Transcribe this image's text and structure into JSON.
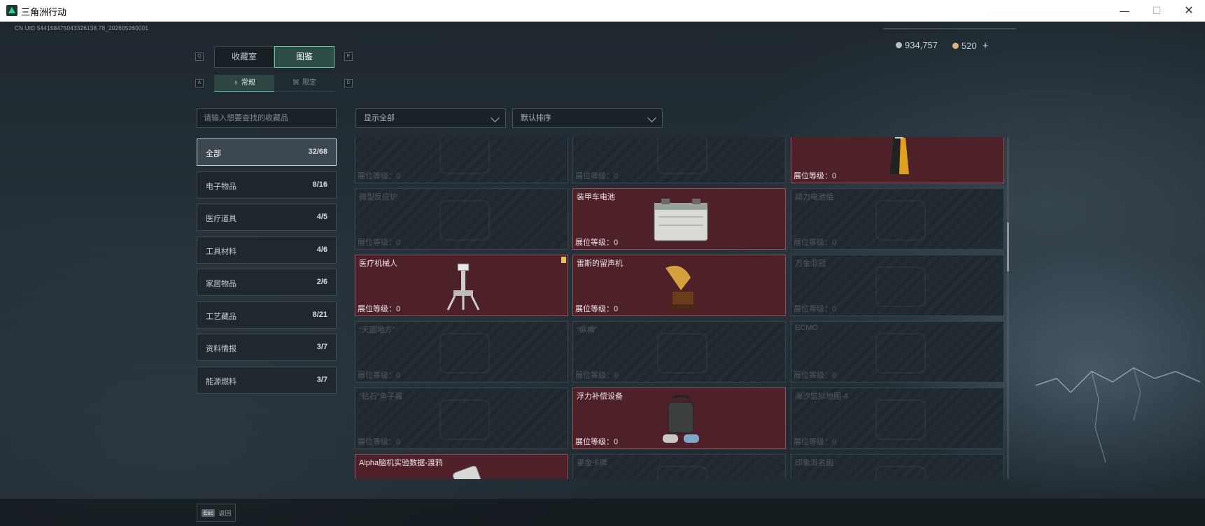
{
  "window": {
    "title": "三角洲行动"
  },
  "uid": "CN UID 544158475043326138 78_202605260001",
  "currency": {
    "silver": "934,757",
    "gold": "520",
    "plus": "+"
  },
  "tabs": [
    {
      "label": "收藏室",
      "key": "Q"
    },
    {
      "label": "图鉴",
      "key": "E"
    }
  ],
  "subtabs": [
    {
      "label": "常规",
      "key": "A"
    },
    {
      "label": "限定",
      "key": "D"
    }
  ],
  "search": {
    "placeholder": "请输入想要查找的收藏品"
  },
  "filters": {
    "show": "显示全部",
    "sort": "默认排序"
  },
  "categories": [
    {
      "name": "全部",
      "count": "32/68"
    },
    {
      "name": "电子物品",
      "count": "8/16"
    },
    {
      "name": "医疗道具",
      "count": "4/5"
    },
    {
      "name": "工具材料",
      "count": "4/6"
    },
    {
      "name": "家居物品",
      "count": "2/6"
    },
    {
      "name": "工艺藏品",
      "count": "8/21"
    },
    {
      "name": "资料情报",
      "count": "3/7"
    },
    {
      "name": "能源燃料",
      "count": "3/7"
    }
  ],
  "level_label": "展位等级：",
  "items": [
    {
      "name": "",
      "level": "0",
      "owned": false
    },
    {
      "name": "",
      "level": "0",
      "owned": false
    },
    {
      "name": "",
      "level": "0",
      "owned": true,
      "art": "bag-icon"
    },
    {
      "name": "微型反应炉",
      "level": "0",
      "owned": false
    },
    {
      "name": "装甲车电池",
      "level": "0",
      "owned": true,
      "art": "battery-icon"
    },
    {
      "name": "动力电池组",
      "level": "0",
      "owned": false
    },
    {
      "name": "医疗机械人",
      "level": "0",
      "owned": true,
      "art": "robot-icon",
      "flag": true
    },
    {
      "name": "雷斯的留声机",
      "level": "0",
      "owned": true,
      "art": "gramophone-icon"
    },
    {
      "name": "万金泪冠",
      "level": "0",
      "owned": false
    },
    {
      "name": "“天圆地方”",
      "level": "0",
      "owned": false
    },
    {
      "name": "“纵横”",
      "level": "0",
      "owned": false
    },
    {
      "name": "ECMO",
      "level": "0",
      "owned": false
    },
    {
      "name": "“钻石”鱼子酱",
      "level": "0",
      "owned": false
    },
    {
      "name": "浮力补偿设备",
      "level": "0",
      "owned": true,
      "art": "bcd-icon"
    },
    {
      "name": "海汐监狱地图-4",
      "level": "0",
      "owned": false
    },
    {
      "name": "Alpha脑机实验数据-渡鸦",
      "level": "",
      "owned": true,
      "art": "device-icon"
    },
    {
      "name": "鎏金卡牌",
      "level": "",
      "owned": false
    },
    {
      "name": "印象派名画",
      "level": "",
      "owned": false
    }
  ],
  "footer": {
    "esc_key": "Esc",
    "esc_label": "返回"
  },
  "colors": {
    "accent": "#67c6a2",
    "owned_card": "#4e2129",
    "empty_card": "#1f282e"
  }
}
